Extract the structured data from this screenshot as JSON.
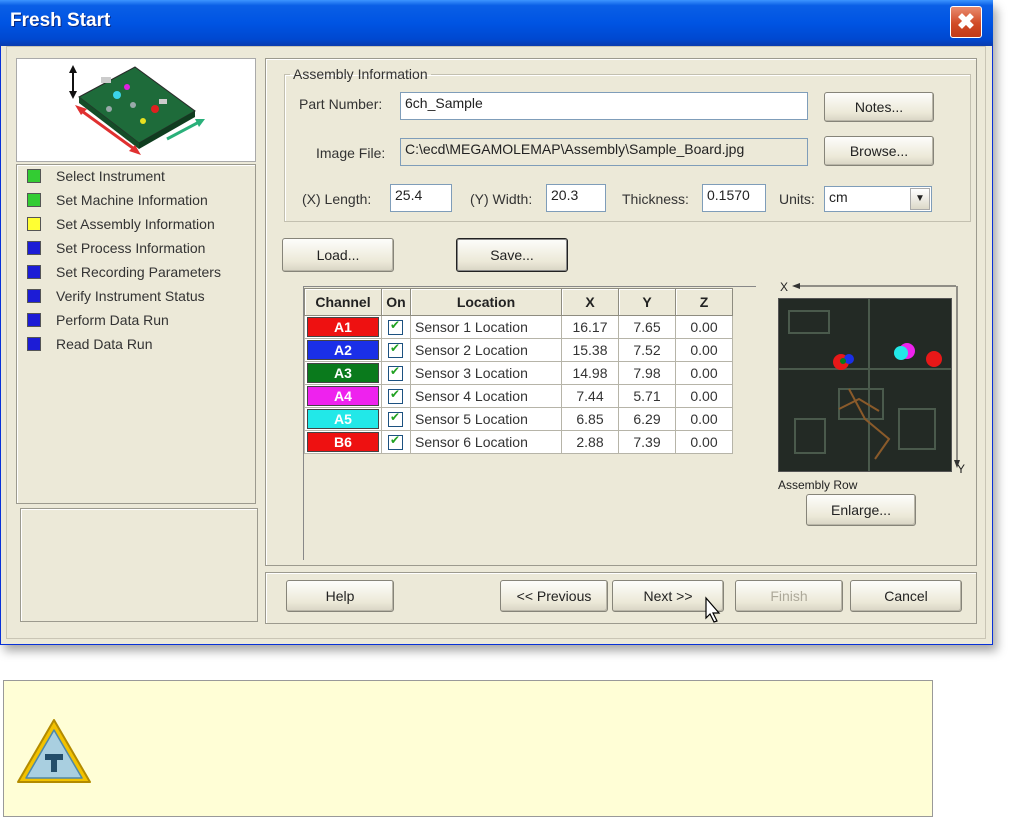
{
  "window": {
    "title": "Fresh Start",
    "close_icon": "✖"
  },
  "steps": [
    {
      "label": "Select Instrument",
      "color": "#33cc33"
    },
    {
      "label": "Set Machine Information",
      "color": "#33cc33"
    },
    {
      "label": "Set Assembly Information",
      "color": "#ffff33"
    },
    {
      "label": "Set Process Information",
      "color": "#1c1cd6"
    },
    {
      "label": "Set Recording Parameters",
      "color": "#1c1cd6"
    },
    {
      "label": "Verify Instrument Status",
      "color": "#1c1cd6"
    },
    {
      "label": "Perform Data Run",
      "color": "#1c1cd6"
    },
    {
      "label": "Read Data Run",
      "color": "#1c1cd6"
    }
  ],
  "assembly": {
    "legend": "Assembly Information",
    "part_number_label": "Part Number:",
    "part_number": "6ch_Sample",
    "image_file_label": "Image File:",
    "image_file": "C:\\ecd\\MEGAMOLEMAP\\Assembly\\Sample_Board.jpg",
    "notes_button": "Notes...",
    "browse_button": "Browse...",
    "length_label": "(X) Length:",
    "length": "25.4",
    "width_label": "(Y) Width:",
    "width": "20.3",
    "thickness_label": "Thickness:",
    "thickness": "0.1570",
    "units_label": "Units:",
    "units": "cm"
  },
  "load_button": "Load...",
  "save_button": "Save...",
  "table": {
    "headers": [
      "Channel",
      "On",
      "Location",
      "X",
      "Y",
      "Z"
    ],
    "rows": [
      {
        "channel": "A1",
        "color": "#ee1111",
        "location": "Sensor 1 Location",
        "x": "16.17",
        "y": "7.65",
        "z": "0.00"
      },
      {
        "channel": "A2",
        "color": "#1a2fe8",
        "location": "Sensor 2 Location",
        "x": "15.38",
        "y": "7.52",
        "z": "0.00"
      },
      {
        "channel": "A3",
        "color": "#0a7a1c",
        "location": "Sensor 3 Location",
        "x": "14.98",
        "y": "7.98",
        "z": "0.00"
      },
      {
        "channel": "A4",
        "color": "#ee22ee",
        "location": "Sensor 4 Location",
        "x": "7.44",
        "y": "5.71",
        "z": "0.00"
      },
      {
        "channel": "A5",
        "color": "#22e8e8",
        "location": "Sensor 5 Location",
        "x": "6.85",
        "y": "6.29",
        "z": "0.00"
      },
      {
        "channel": "B6",
        "color": "#ee1111",
        "location": "Sensor 6 Location",
        "x": "2.88",
        "y": "7.39",
        "z": "0.00"
      }
    ]
  },
  "preview": {
    "x_axis": "X",
    "y_axis": "Y",
    "caption": "Assembly Row",
    "enlarge_button": "Enlarge..."
  },
  "bottom": {
    "help": "Help",
    "previous": "<< Previous",
    "next": "Next >>",
    "finish": "Finish",
    "cancel": "Cancel"
  }
}
